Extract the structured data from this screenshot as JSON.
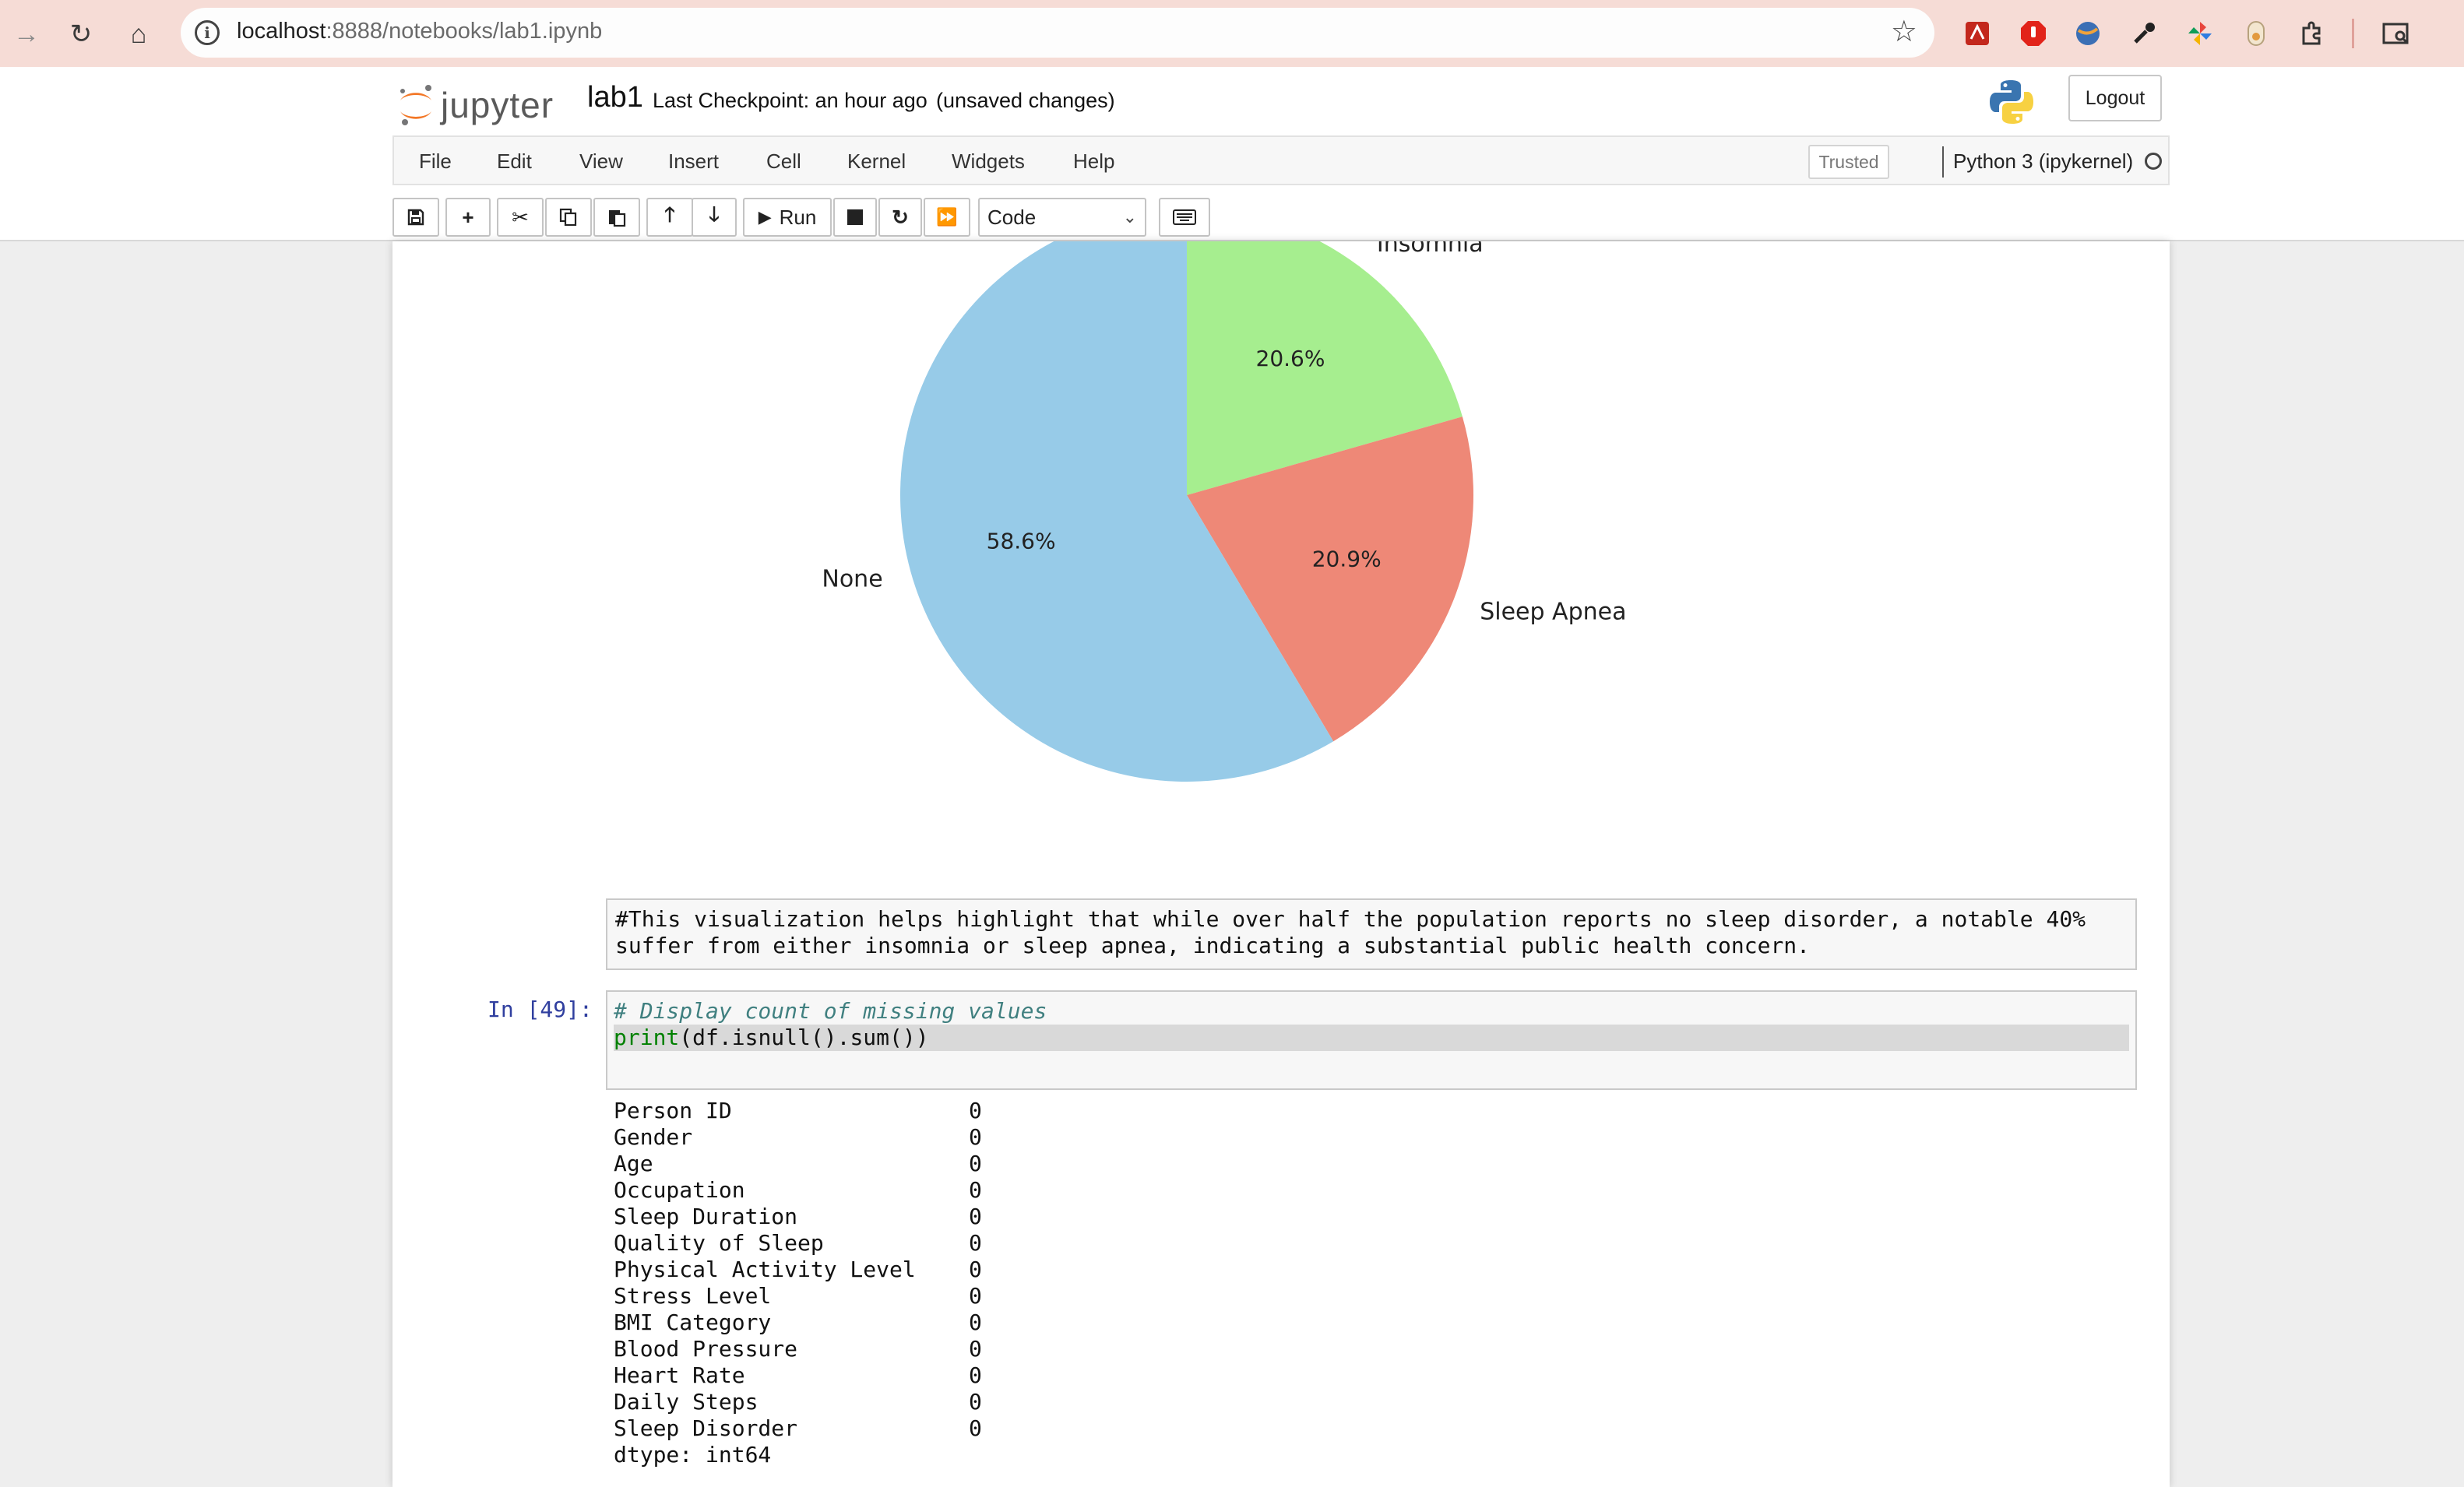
{
  "browser": {
    "url_host": "localhost",
    "url_path": ":8888/notebooks/lab1.ipynb"
  },
  "header": {
    "logo_text": "jupyter",
    "notebook_name": "lab1",
    "checkpoint": "Last Checkpoint: an hour ago",
    "unsaved": "(unsaved changes)",
    "logout": "Logout"
  },
  "menu": {
    "items": [
      "File",
      "Edit",
      "View",
      "Insert",
      "Cell",
      "Kernel",
      "Widgets",
      "Help"
    ],
    "trusted": "Trusted",
    "kernel": "Python 3 (ipykernel)"
  },
  "toolbar": {
    "run_label": "Run",
    "cell_type": "Code"
  },
  "chart_data": {
    "type": "pie",
    "slices": [
      {
        "label": "Insomnia",
        "value": 20.6,
        "label_text": "20.6%",
        "color": "#a6ee8f"
      },
      {
        "label": "Sleep Apnea",
        "value": 20.9,
        "label_text": "20.9%",
        "color": "#ee8877"
      },
      {
        "label": "None",
        "value": 58.6,
        "label_text": "58.6%",
        "color": "#97cbe8"
      }
    ],
    "start_angle_deg": 90,
    "direction": "clockwise"
  },
  "cells": {
    "markdown_lines": [
      "#This visualization helps highlight that while over half the population reports no sleep disorder, a notable 40%",
      "suffer from either insomnia or sleep apnea, indicating a substantial public health concern."
    ],
    "code_prompt": "In [49]:",
    "code_comment": "# Display count of missing values",
    "code_builtin": "print",
    "code_rest": "(df.isnull().sum())",
    "output_rows": [
      {
        "key": "Person ID",
        "value": "0"
      },
      {
        "key": "Gender",
        "value": "0"
      },
      {
        "key": "Age",
        "value": "0"
      },
      {
        "key": "Occupation",
        "value": "0"
      },
      {
        "key": "Sleep Duration",
        "value": "0"
      },
      {
        "key": "Quality of Sleep",
        "value": "0"
      },
      {
        "key": "Physical Activity Level",
        "value": "0"
      },
      {
        "key": "Stress Level",
        "value": "0"
      },
      {
        "key": "BMI Category",
        "value": "0"
      },
      {
        "key": "Blood Pressure",
        "value": "0"
      },
      {
        "key": "Heart Rate",
        "value": "0"
      },
      {
        "key": "Daily Steps",
        "value": "0"
      },
      {
        "key": "Sleep Disorder",
        "value": "0"
      }
    ],
    "dtype_line": "dtype: int64"
  }
}
